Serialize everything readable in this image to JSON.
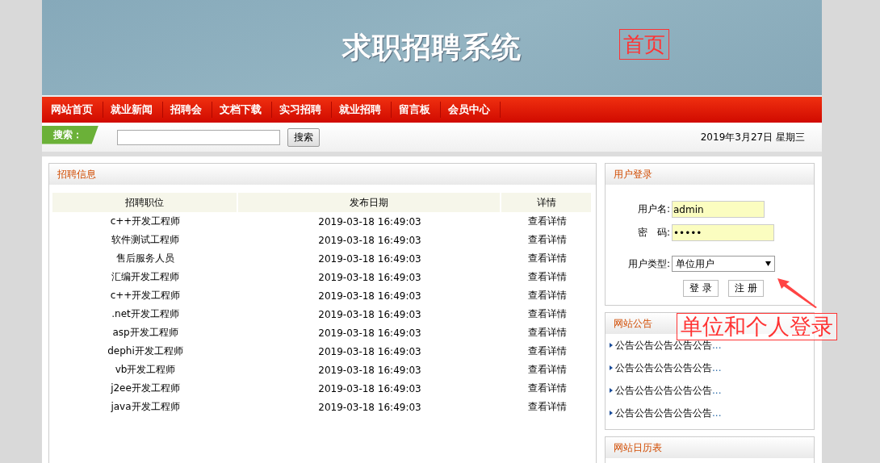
{
  "header": {
    "title": "求职招聘系统"
  },
  "nav": [
    "网站首页",
    "就业新闻",
    "招聘会",
    "文档下载",
    "实习招聘",
    "就业招聘",
    "留言板",
    "会员中心"
  ],
  "search": {
    "label": "搜索：",
    "button": "搜索",
    "date": "2019年3月27日 星期三"
  },
  "jobs": {
    "title": "招聘信息",
    "columns": [
      "招聘职位",
      "发布日期",
      "详情"
    ],
    "rows": [
      {
        "position": "c++开发工程师",
        "date": "2019-03-18 16:49:03",
        "link": "查看详情"
      },
      {
        "position": "软件测试工程师",
        "date": "2019-03-18 16:49:03",
        "link": "查看详情"
      },
      {
        "position": "售后服务人员",
        "date": "2019-03-18 16:49:03",
        "link": "查看详情"
      },
      {
        "position": "汇编开发工程师",
        "date": "2019-03-18 16:49:03",
        "link": "查看详情"
      },
      {
        "position": "c++开发工程师",
        "date": "2019-03-18 16:49:03",
        "link": "查看详情"
      },
      {
        "position": ".net开发工程师",
        "date": "2019-03-18 16:49:03",
        "link": "查看详情"
      },
      {
        "position": "asp开发工程师",
        "date": "2019-03-18 16:49:03",
        "link": "查看详情"
      },
      {
        "position": "dephi开发工程师",
        "date": "2019-03-18 16:49:03",
        "link": "查看详情"
      },
      {
        "position": "vb开发工程师",
        "date": "2019-03-18 16:49:03",
        "link": "查看详情"
      },
      {
        "position": "j2ee开发工程师",
        "date": "2019-03-18 16:49:03",
        "link": "查看详情"
      },
      {
        "position": "java开发工程师",
        "date": "2019-03-18 16:49:03",
        "link": "查看详情"
      }
    ]
  },
  "login": {
    "title": "用户登录",
    "username_label": "用户名:",
    "username": "admin",
    "password_label": "密　码:",
    "password": "•••••",
    "type_label": "用户类型:",
    "type": "单位用户",
    "buttons": [
      "登 录",
      "注 册"
    ]
  },
  "notices": {
    "title": "网站公告",
    "items": [
      {
        "text": "公告公告公告公告公告",
        "more": "..."
      },
      {
        "text": "公告公告公告公告公告",
        "more": "..."
      },
      {
        "text": "公告公告公告公告公告",
        "more": "..."
      },
      {
        "text": "公告公告公告公告公告",
        "more": "..."
      }
    ]
  },
  "calendar": {
    "title": "网站日历表"
  },
  "annotations": [
    {
      "kind": "box",
      "text": "首页"
    },
    {
      "kind": "arrow-box",
      "text": "单位和个人登录"
    }
  ]
}
